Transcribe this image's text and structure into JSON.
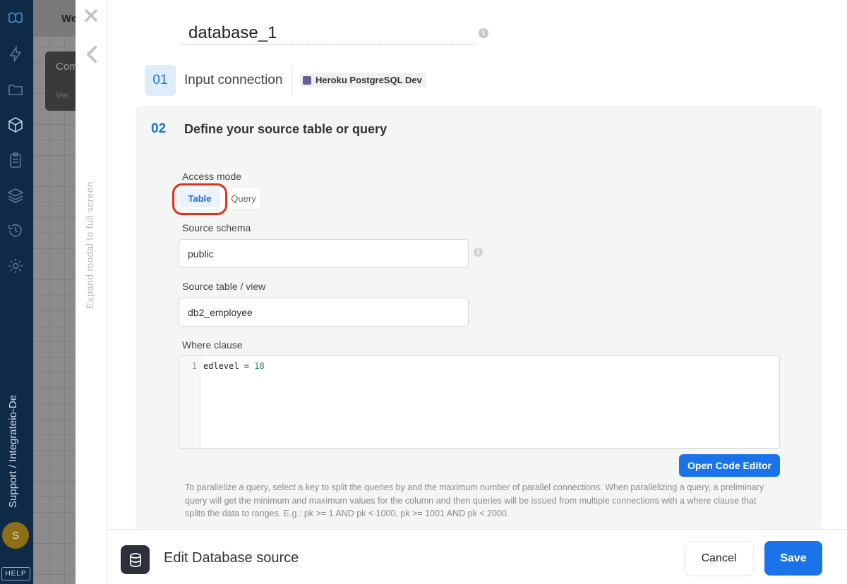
{
  "sidebar": {
    "icons": [
      "logo-icon",
      "bolt-icon",
      "folder-icon",
      "package-icon",
      "clipboard-icon",
      "layers-icon",
      "history-icon",
      "gear-icon"
    ],
    "workspace_label": "Support / Integrateio-De",
    "avatar_initial": "S",
    "help_label": "HELP"
  },
  "background": {
    "tab_label": "We",
    "card_title": "Com",
    "card_version": "Ver."
  },
  "modal_rail": {
    "expand_label": "Expand modal to full screen"
  },
  "component": {
    "name": "database_1"
  },
  "step1": {
    "number": "01",
    "label": "Input connection",
    "connection_name": "Heroku PostgreSQL Dev"
  },
  "step2": {
    "number": "02",
    "title": "Define your source table or query",
    "access_mode_label": "Access mode",
    "access_modes": [
      "Table",
      "Query"
    ],
    "access_mode_selected": "Table",
    "schema_label": "Source schema",
    "schema_value": "public",
    "table_label": "Source table / view",
    "table_value": "db2_employee",
    "where_label": "Where clause",
    "where_line_number": "1",
    "where_code_ident": "edlevel",
    "where_code_op": " = ",
    "where_code_value": "18",
    "open_editor_label": "Open Code Editor",
    "help_text": "To parallelize a query, select a key to split the queries by and the maximum number of parallel connections. When parallelizing a query, a preliminary query will get the minimum and maximum values for the column and then queries will be issued from multiple connections with a where clause that splits the data to ranges. E.g.: pk >= 1 AND pk < 1000, pk >= 1001 AND pk < 2000."
  },
  "footer": {
    "title": "Edit Database source",
    "cancel_label": "Cancel",
    "save_label": "Save"
  },
  "colors": {
    "accent": "#1a73e8",
    "sidebar_bg": "#0e2a47",
    "highlight_ring": "#e0321f"
  }
}
